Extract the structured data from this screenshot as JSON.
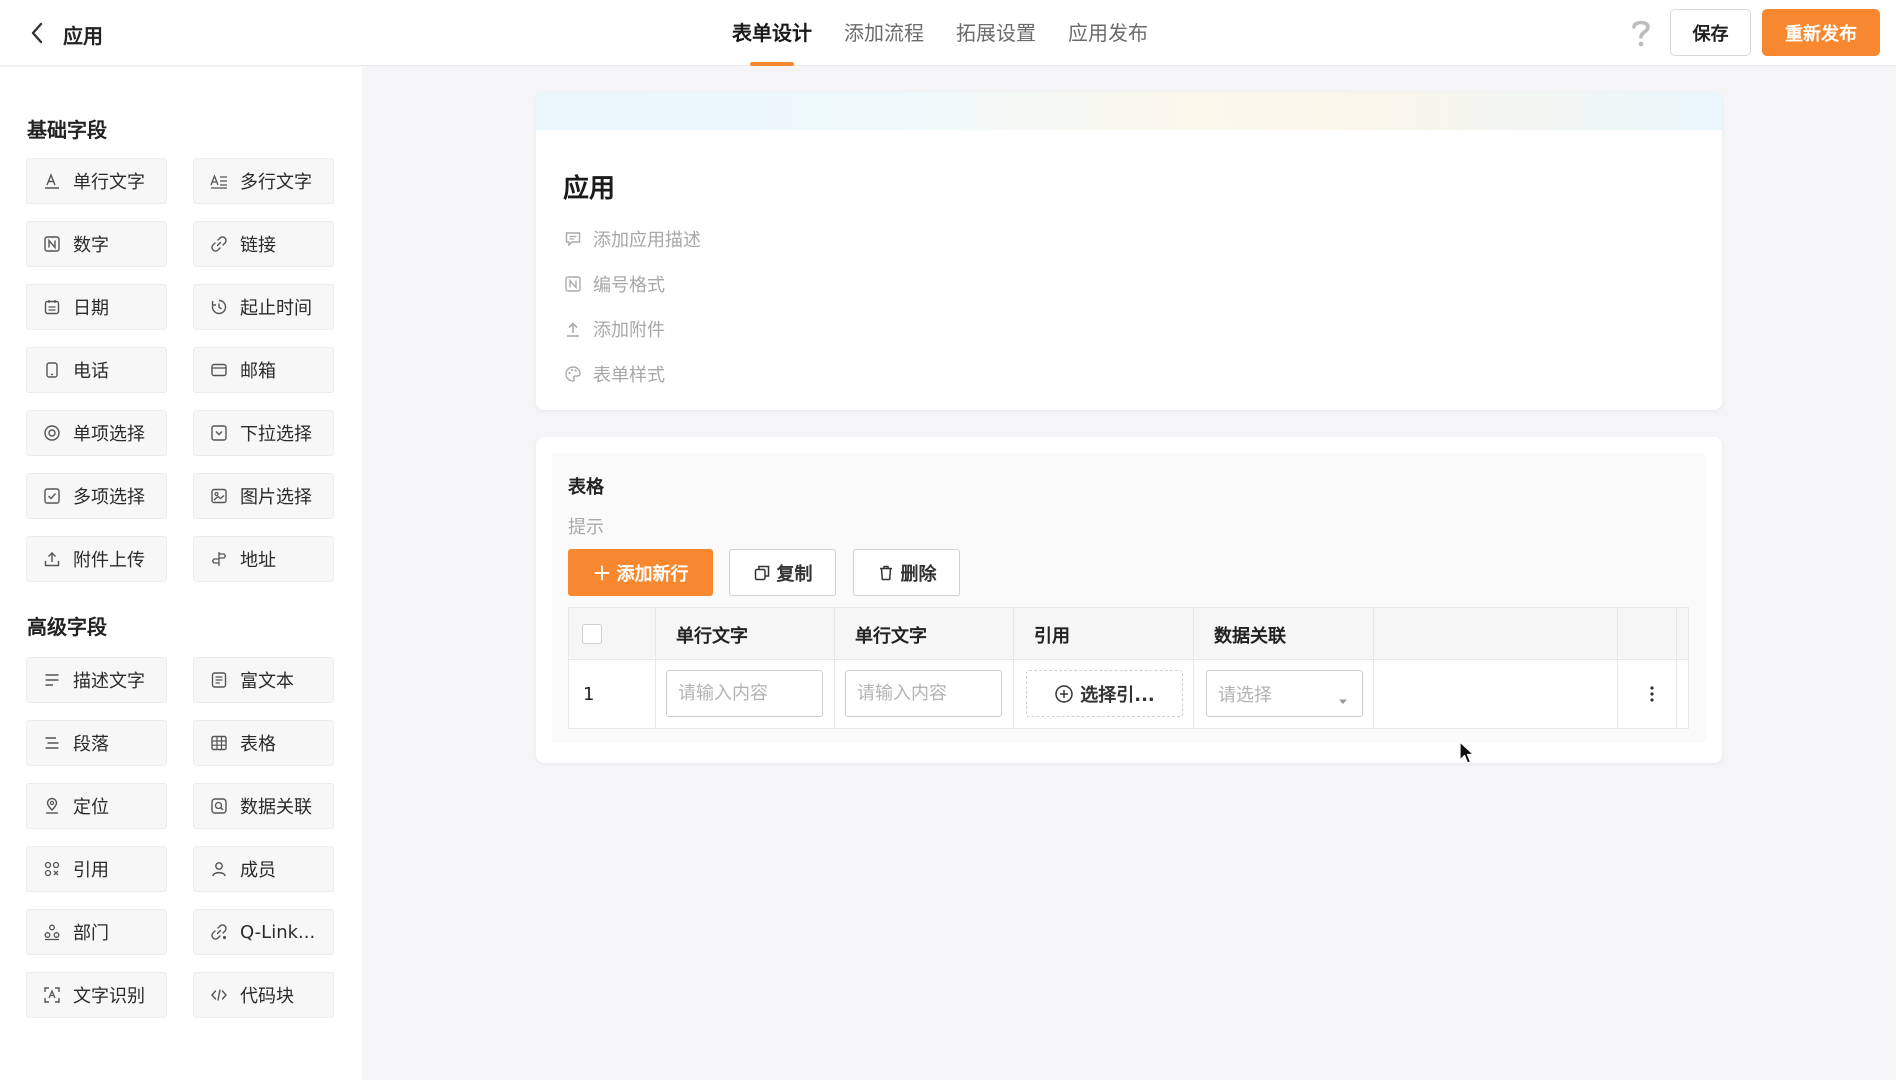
{
  "header": {
    "title": "应用",
    "tabs": [
      {
        "label": "表单设计",
        "active": true
      },
      {
        "label": "添加流程",
        "active": false
      },
      {
        "label": "拓展设置",
        "active": false
      },
      {
        "label": "应用发布",
        "active": false
      }
    ],
    "save_label": "保存",
    "publish_label": "重新发布",
    "accent_color": "#f7882f"
  },
  "sidebar": {
    "basic_title": "基础字段",
    "basic_fields": [
      {
        "label": "单行文字",
        "icon": "text-icon"
      },
      {
        "label": "多行文字",
        "icon": "multiline-text-icon"
      },
      {
        "label": "数字",
        "icon": "number-icon"
      },
      {
        "label": "链接",
        "icon": "link-icon"
      },
      {
        "label": "日期",
        "icon": "calendar-icon"
      },
      {
        "label": "起止时间",
        "icon": "time-range-icon"
      },
      {
        "label": "电话",
        "icon": "phone-icon"
      },
      {
        "label": "邮箱",
        "icon": "mail-icon"
      },
      {
        "label": "单项选择",
        "icon": "radio-icon"
      },
      {
        "label": "下拉选择",
        "icon": "dropdown-icon"
      },
      {
        "label": "多项选择",
        "icon": "checkbox-icon"
      },
      {
        "label": "图片选择",
        "icon": "image-icon"
      },
      {
        "label": "附件上传",
        "icon": "upload-icon"
      },
      {
        "label": "地址",
        "icon": "address-icon"
      }
    ],
    "advanced_title": "高级字段",
    "advanced_fields": [
      {
        "label": "描述文字",
        "icon": "description-icon"
      },
      {
        "label": "富文本",
        "icon": "rich-text-icon"
      },
      {
        "label": "段落",
        "icon": "paragraph-icon"
      },
      {
        "label": "表格",
        "icon": "table-icon"
      },
      {
        "label": "定位",
        "icon": "location-icon"
      },
      {
        "label": "数据关联",
        "icon": "data-link-icon"
      },
      {
        "label": "引用",
        "icon": "reference-icon"
      },
      {
        "label": "成员",
        "icon": "member-icon"
      },
      {
        "label": "部门",
        "icon": "department-icon"
      },
      {
        "label": "Q-Link...",
        "icon": "qlink-icon"
      },
      {
        "label": "文字识别",
        "icon": "ocr-icon"
      },
      {
        "label": "代码块",
        "icon": "code-icon"
      }
    ]
  },
  "form": {
    "title": "应用",
    "meta": [
      {
        "label": "添加应用描述",
        "icon": "comment-icon"
      },
      {
        "label": "编号格式",
        "icon": "number-format-icon"
      },
      {
        "label": "添加附件",
        "icon": "attach-upload-icon"
      },
      {
        "label": "表单样式",
        "icon": "palette-icon"
      }
    ]
  },
  "table": {
    "title": "表格",
    "hint": "提示",
    "add_row_label": "添加新行",
    "copy_label": "复制",
    "delete_label": "删除",
    "columns": [
      "单行文字",
      "单行文字",
      "引用",
      "数据关联"
    ],
    "row_number": "1",
    "input_placeholder": "请输入内容",
    "reference_label": "选择引...",
    "select_placeholder": "请选择"
  }
}
